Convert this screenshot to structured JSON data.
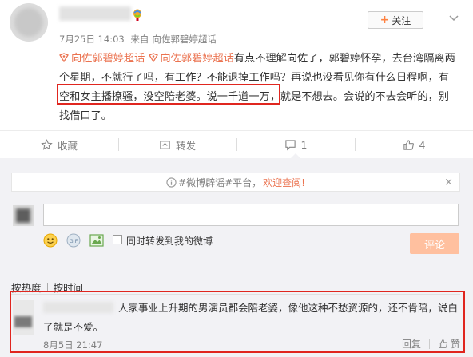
{
  "header": {
    "follow_label": "关注",
    "date": "7月25日 14:03",
    "source_prefix": "来自",
    "source": "向佐郭碧婷超话"
  },
  "post": {
    "topic1": "向佐郭碧婷超话",
    "topic2": "向佐郭碧婷超话",
    "text_part1": "有点不理解向佐了，郭碧婷怀孕，去台湾隔离两个星期，不就行了吗，有工作？不能退掉工作吗？再说也没看见你有什么日程啊，",
    "highlighted": "有空和女主播撩骚，没空陪老婆。",
    "text_part2": "说一千道一万，就是不想去。会说的不去会听的，别找借口了。"
  },
  "actions": {
    "favorite": "收藏",
    "repost": "转发",
    "comment_count": "1",
    "like_count": "4"
  },
  "composer": {
    "notice_prefix": "#微博辟谣#平台，",
    "notice_link": "欢迎查阅!",
    "notice_close": "×",
    "repost_label": "同时转发到我的微博",
    "submit_label": "评论"
  },
  "sort": {
    "by_heat": "按热度",
    "by_time": "按时间"
  },
  "comment": {
    "text": "人家事业上升期的男演员都会陪老婆，像他这种不愁资源的，还不肯陪，说白了就是不爱。",
    "time": "8月5日 21:47",
    "reply": "回复",
    "like": "赞"
  },
  "colors": {
    "accent": "#eb7350",
    "highlight_border": "#e0261f",
    "panel_bg": "#f2f2f5",
    "submit_bg": "#ffc09f"
  }
}
